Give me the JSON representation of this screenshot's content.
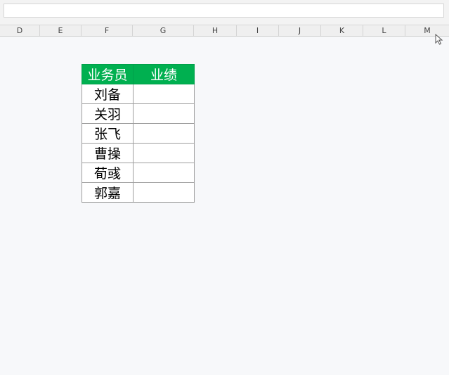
{
  "columns": [
    "D",
    "E",
    "F",
    "G",
    "H",
    "I",
    "J",
    "K",
    "L",
    "M"
  ],
  "table": {
    "headers": [
      "业务员",
      "业绩"
    ],
    "rows": [
      {
        "name": "刘备",
        "score": ""
      },
      {
        "name": "关羽",
        "score": ""
      },
      {
        "name": "张飞",
        "score": ""
      },
      {
        "name": "曹操",
        "score": ""
      },
      {
        "name": "荀彧",
        "score": ""
      },
      {
        "name": "郭嘉",
        "score": ""
      }
    ],
    "header_color": "#00b050"
  },
  "icons": {
    "cursor": "mouse-pointer-icon"
  }
}
